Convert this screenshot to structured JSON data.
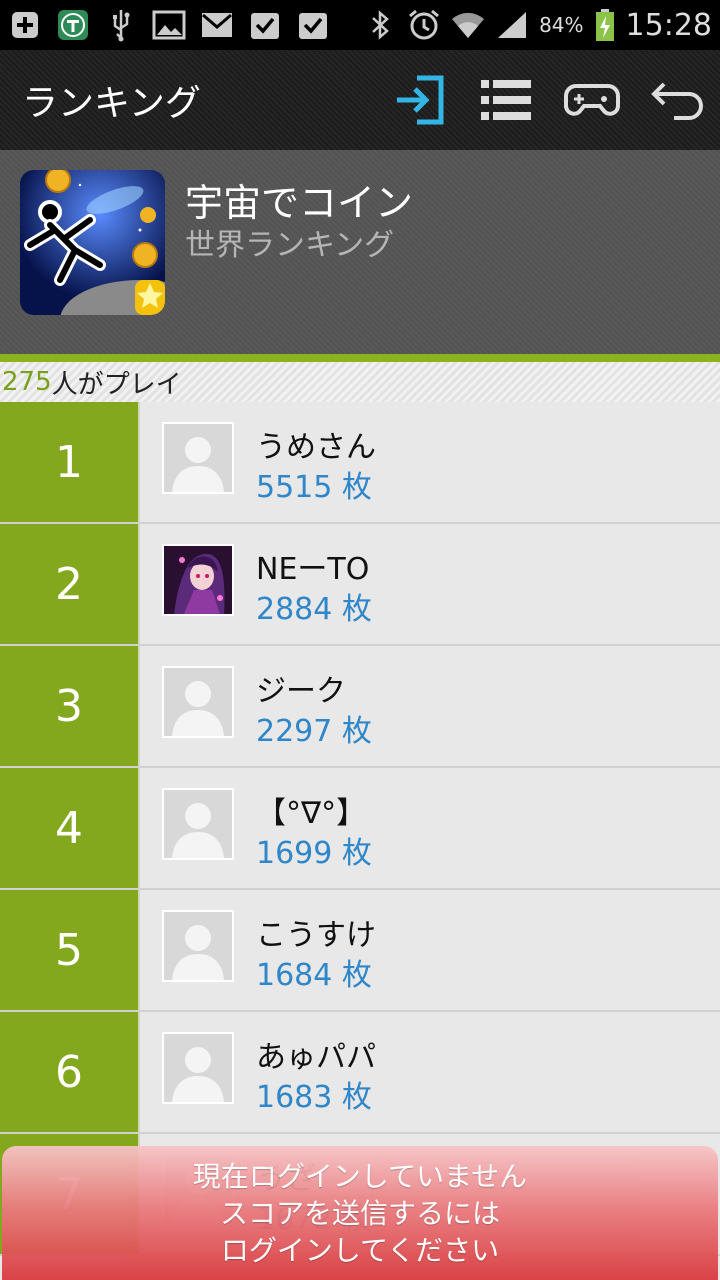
{
  "status_bar": {
    "battery_percent": "84%",
    "time": "15:28"
  },
  "action_bar": {
    "title": "ランキング",
    "actions": [
      "login-icon",
      "list-icon",
      "gamepad-icon",
      "back-icon"
    ],
    "accent_color": "#33b5e5"
  },
  "game": {
    "title": "宇宙でコイン",
    "subtitle": "世界ランキング"
  },
  "play_count": {
    "number": "275",
    "suffix": "人がプレイ"
  },
  "ranking": [
    {
      "rank": "1",
      "name": "うめさん",
      "score": "5515 枚",
      "avatar": "default"
    },
    {
      "rank": "2",
      "name": "NEーTO",
      "score": "2884 枚",
      "avatar": "custom"
    },
    {
      "rank": "3",
      "name": "ジーク",
      "score": "2297 枚",
      "avatar": "default"
    },
    {
      "rank": "4",
      "name": "【°∇°】",
      "score": "1699 枚",
      "avatar": "default"
    },
    {
      "rank": "5",
      "name": "こうすけ",
      "score": "1684 枚",
      "avatar": "default"
    },
    {
      "rank": "6",
      "name": "あゅパパ",
      "score": "1683 枚",
      "avatar": "default"
    },
    {
      "rank": "7",
      "name": "うざ",
      "score": "1672 枚",
      "avatar": "default"
    }
  ],
  "toast": {
    "line1": "現在ログインしていません",
    "line2": "スコアを送信するには",
    "line3": "ログインしてください"
  },
  "colors": {
    "rank_green": "#83a81e",
    "score_blue": "#2f86c8",
    "toast_red": "#d93a3e"
  }
}
